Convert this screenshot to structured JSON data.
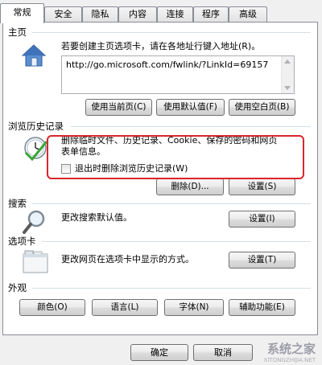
{
  "tabs": [
    "常规",
    "安全",
    "隐私",
    "内容",
    "连接",
    "程序",
    "高级"
  ],
  "homepage": {
    "title": "主页",
    "instruction": "若要创建主页选项卡，请在各地址行键入地址(R)。",
    "url": "http://go.microsoft.com/fwlink/?LinkId=69157",
    "buttons": [
      "使用当前页(C)",
      "使用默认值(F)",
      "使用空白页(B)"
    ]
  },
  "history": {
    "title": "浏览历史记录",
    "description_line1": "删除临时文件、历史记录、Cookie、保存的密码和网页",
    "description_line2": "表单信息。",
    "checkbox_label": "退出时删除浏览历史记录(W)",
    "delete_button": "删除(D)...",
    "settings_button": "设置(S)"
  },
  "search": {
    "title": "搜索",
    "description": "更改搜索默认值。",
    "settings_button": "设置(I)"
  },
  "tabs_section": {
    "title": "选项卡",
    "description": "更改网页在选项卡中显示的方式。",
    "settings_button": "设置(T)"
  },
  "appearance": {
    "title": "外观",
    "buttons": [
      "颜色(O)",
      "语言(L)",
      "字体(N)",
      "辅助功能(E)"
    ]
  },
  "footer": {
    "ok": "确定",
    "cancel": "取消"
  },
  "watermark": {
    "text": "系统之家",
    "sub": "XITONGZHIJIA.NET"
  },
  "colors": {
    "highlight": "#d9262c"
  }
}
